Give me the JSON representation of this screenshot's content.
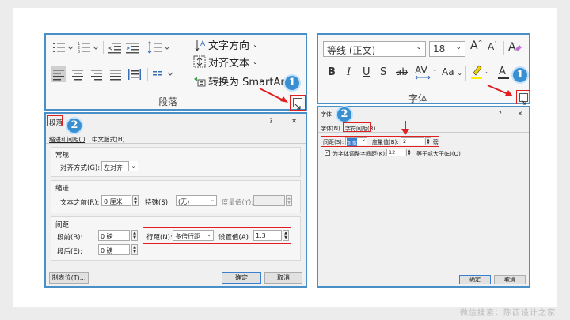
{
  "colors": {
    "accent_border": "#4a90c8",
    "highlight": "#e02020",
    "badge": "#3a8fd0"
  },
  "para_ribbon": {
    "text_direction": "文字方向",
    "align_text": "对齐文本",
    "convert_smartart": "转换为 SmartArt",
    "group_label": "段落",
    "badge": "1",
    "icons": [
      "bullets-icon",
      "numbering-icon",
      "multilevel-list-icon",
      "decrease-indent-icon",
      "increase-indent-icon",
      "line-spacing-icon",
      "align-left-icon",
      "center-icon",
      "align-right-icon",
      "justify-icon",
      "distribute-icon",
      "columns-icon",
      "dialog-launcher-icon"
    ]
  },
  "font_ribbon": {
    "font_name": "等线 (正文)",
    "font_size": "18",
    "bold": "B",
    "italic": "I",
    "underline": "U",
    "shadow": "S",
    "strike": "ab",
    "spacing": "AV",
    "case": "Aa",
    "group_label": "字体",
    "badge": "1",
    "icons": [
      "grow-font-icon",
      "shrink-font-icon",
      "clear-format-icon",
      "highlight-icon",
      "font-color-icon",
      "dialog-launcher-icon"
    ]
  },
  "para_dialog": {
    "title": "段落",
    "badge": "2",
    "help": "?",
    "close": "✕",
    "tabs": [
      "缩进和间距(I)",
      "中文版式(H)"
    ],
    "general_title": "常规",
    "align_label": "对齐方式(G):",
    "align_value": "左对齐",
    "indent_title": "缩进",
    "before_text_label": "文本之前(R):",
    "before_text_value": "0 厘米",
    "special_label": "特殊(S):",
    "special_value": "(无)",
    "measure_label": "度量值(Y):",
    "spacing_title": "间距",
    "before_label": "段前(B):",
    "before_value": "0 磅",
    "after_label": "段后(E):",
    "after_value": "0 磅",
    "line_spacing_label": "行距(N):",
    "line_spacing_value": "多倍行距",
    "set_value_label": "设置值(A)",
    "set_value": "1.3",
    "tabs_button": "制表位(T)...",
    "ok": "确定",
    "cancel": "取消"
  },
  "font_dialog": {
    "title": "字体",
    "badge": "2",
    "help": "?",
    "close": "✕",
    "tabs": [
      "字体(N)",
      "字符间距(R)"
    ],
    "spacing_label": "间距(S):",
    "spacing_value": "加宽",
    "measure_label": "度量值(B):",
    "measure_value": "2",
    "unit": "磅",
    "kerning_label": "为字体调整字间距(K):",
    "kerning_value": "12",
    "kerning_suffix": "等于或大于(E)(O)",
    "ok": "确定",
    "cancel": "取消"
  },
  "watermark": "微信搜索：陈西设计之家"
}
